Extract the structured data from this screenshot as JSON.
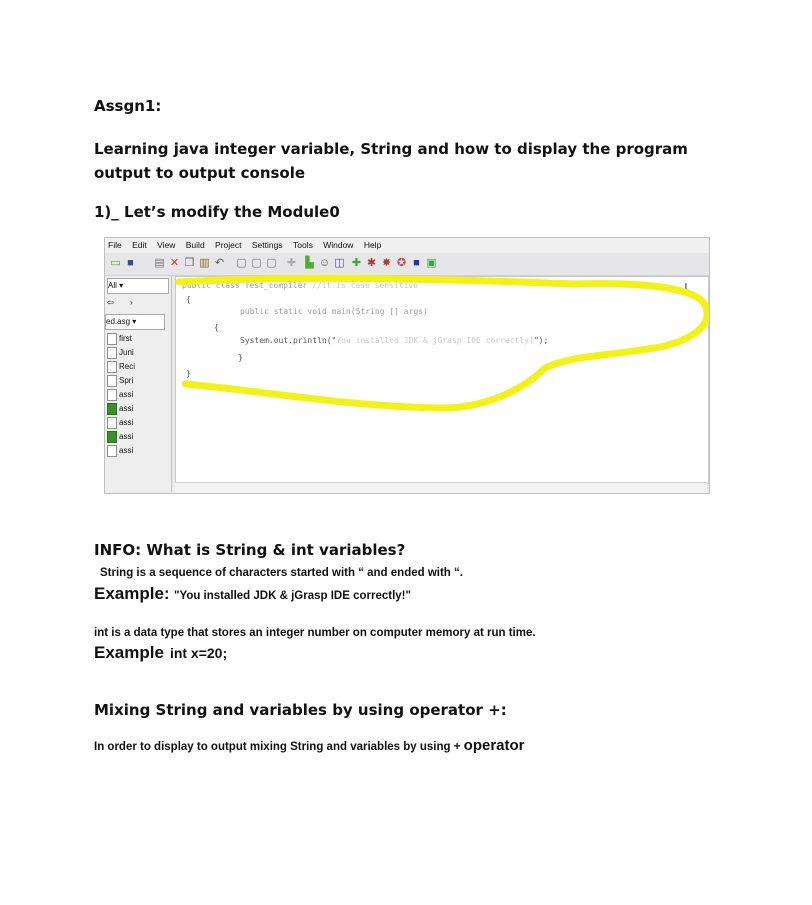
{
  "title": "Assgn1:",
  "subtitle": "Learning java integer variable, String and how to display the program output to output console",
  "step1": "1)_ Let’s modify the Module0",
  "ide": {
    "menu": [
      "File",
      "Edit",
      "View",
      "Build",
      "Project",
      "Settings",
      "Tools",
      "Window",
      "Help"
    ],
    "sidebar_items": [
      {
        "label": "first",
        "type": "file"
      },
      {
        "label": "Juni",
        "type": "file"
      },
      {
        "label": "Reci",
        "type": "file"
      },
      {
        "label": "Spri",
        "type": "file"
      },
      {
        "label": "assi",
        "type": "file"
      },
      {
        "label": "assi",
        "type": "java"
      },
      {
        "label": "assi",
        "type": "file"
      },
      {
        "label": "assi",
        "type": "java"
      },
      {
        "label": "assi",
        "type": "file"
      }
    ],
    "folder_select": "ed.asg",
    "filter_select": "All",
    "code_line1": "public class Test_compiler",
    "code_line1_comment": "//it is case sensitive",
    "code_line2": "{",
    "code_line3": "public static void main(String [] args)",
    "code_line4": "{",
    "code_line5_start": "System.out.println(\"",
    "code_line5_string": "You installed JDK & jGrasp IDE correctly!",
    "code_line5_end": "\");",
    "code_line6": "}",
    "code_line7": "}",
    "highlight_color": "#f2f21a"
  },
  "info": {
    "heading": "INFO: What is String & int variables?",
    "string_def": "String is a sequence of characters started with “ and ended with “.",
    "example_label": "Example:",
    "example_value": "\"You installed JDK & jGrasp IDE correctly!\"",
    "int_def": "int is a data type that stores an  integer number on computer memory at run time.",
    "example2_label": "Example",
    "example2_value": "int x=20;"
  },
  "mixing": {
    "heading": "Mixing String and variables by using operator +:",
    "line": "In order to display to output mixing String and variables by using +",
    "operator_word": "operator"
  }
}
